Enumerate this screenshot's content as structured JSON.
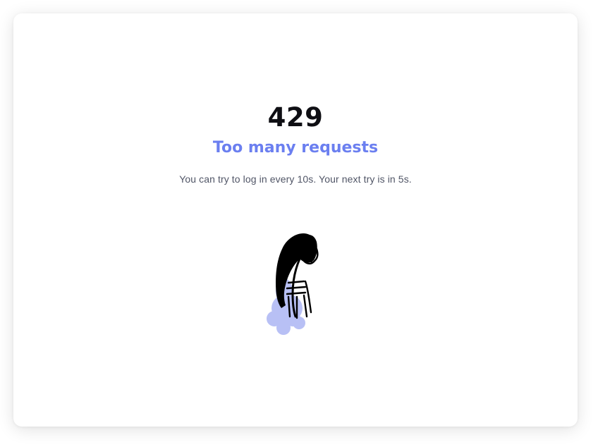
{
  "error": {
    "code": "429",
    "title": "Too many requests",
    "message": "You can try to log in every 10s. Your next try is in 5s."
  },
  "illustration": {
    "icon": "sad-girl-illustration-icon"
  },
  "colors": {
    "accent": "#6b7ff0",
    "text_dark": "#0f0f14",
    "text_muted": "#505566",
    "illustration_blob": "#b8c0f5"
  }
}
